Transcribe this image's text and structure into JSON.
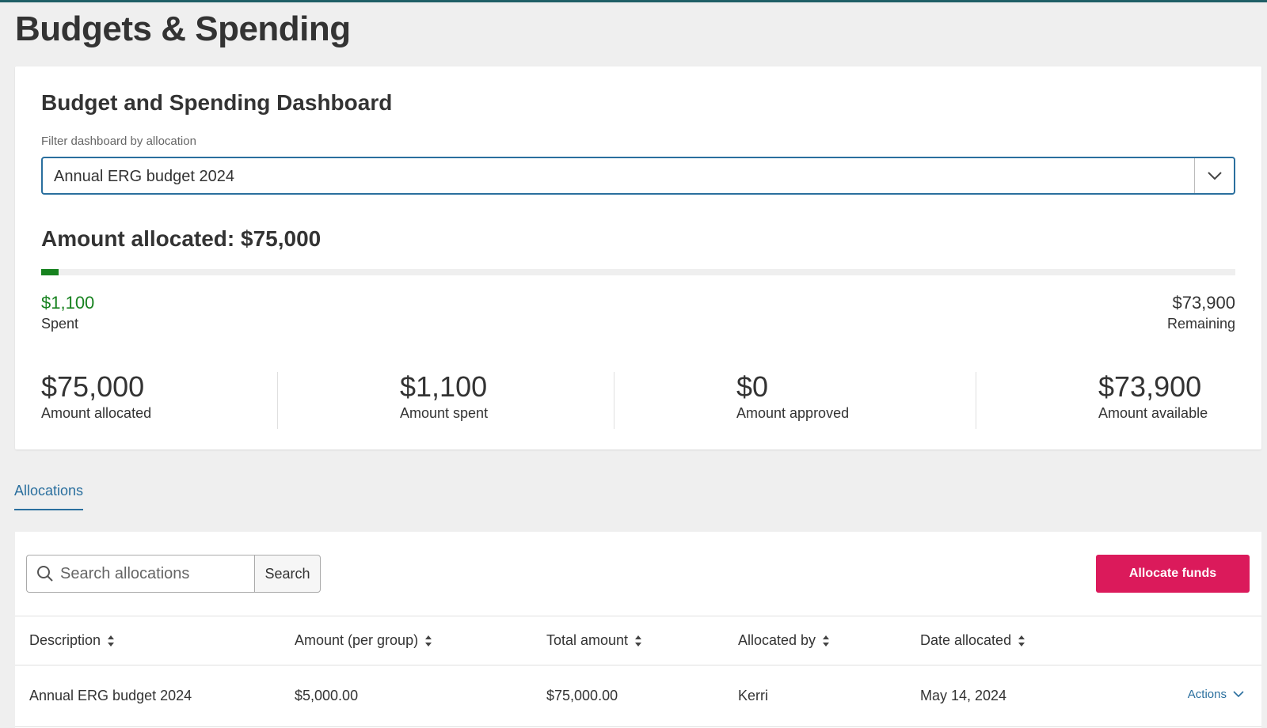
{
  "page": {
    "title": "Budgets & Spending"
  },
  "dashboard": {
    "title": "Budget and Spending Dashboard",
    "filter_label": "Filter dashboard by allocation",
    "filter_value": "Annual ERG budget 2024",
    "allocated_heading": "Amount allocated: $75,000",
    "progress_spent_fraction": 0.0147,
    "spent_amount": "$1,100",
    "spent_label": "Spent",
    "remaining_amount": "$73,900",
    "remaining_label": "Remaining",
    "stats": [
      {
        "value": "$75,000",
        "label": "Amount allocated"
      },
      {
        "value": "$1,100",
        "label": "Amount spent"
      },
      {
        "value": "$0",
        "label": "Amount approved"
      },
      {
        "value": "$73,900",
        "label": "Amount available"
      }
    ]
  },
  "tabs": [
    {
      "label": "Allocations",
      "active": true
    }
  ],
  "allocations": {
    "search_placeholder": "Search allocations",
    "search_button": "Search",
    "allocate_button": "Allocate funds",
    "columns": [
      "Description",
      "Amount (per group)",
      "Total amount",
      "Allocated by",
      "Date allocated"
    ],
    "rows": [
      {
        "description": "Annual ERG budget 2024",
        "amount_per_group": "$5,000.00",
        "total_amount": "$75,000.00",
        "allocated_by": "Kerri",
        "date_allocated": "May 14, 2024",
        "actions_label": "Actions"
      }
    ]
  },
  "colors": {
    "accent_blue": "#2a6f9e",
    "spent_green": "#17821f",
    "primary_button": "#db1a5b"
  }
}
